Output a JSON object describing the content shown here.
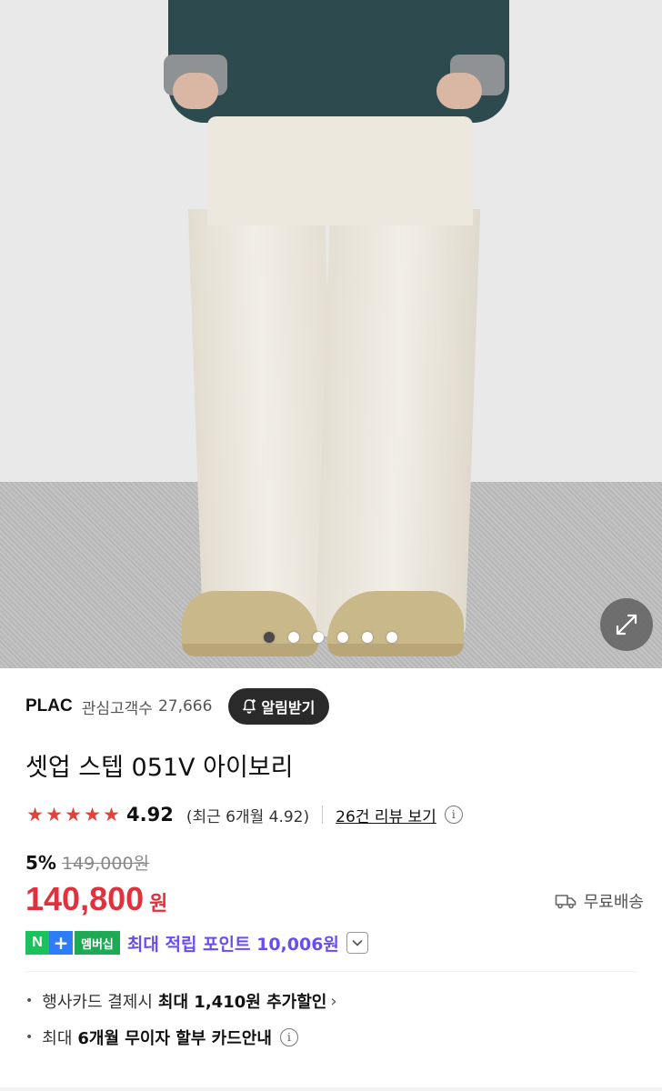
{
  "hero": {
    "dots_total": 6,
    "dots_active_index": 0
  },
  "brand": {
    "name": "PLAC",
    "fans_label": "관심고객수",
    "fans_count": "27,666",
    "alert_button": "알림받기"
  },
  "product": {
    "name": "셋업 스텝 051V 아이보리"
  },
  "rating": {
    "stars": 5,
    "value": "4.92",
    "recent": "(최근 6개월 4.92)",
    "review_link": "26건 리뷰 보기"
  },
  "price": {
    "discount": "5%",
    "original": "149,000원",
    "current": "140,800",
    "unit": "원"
  },
  "shipping": {
    "label": "무료배송"
  },
  "membership": {
    "badge_n": "N",
    "badge_plus": "+",
    "badge_label": "멤버십",
    "points_text": "최대 적립 포인트 10,006원"
  },
  "benefits": {
    "card_discount_prefix": "행사카드 결제시",
    "card_discount_bold": "최대 1,410원 추가할인",
    "installment_prefix": "최대",
    "installment_bold": "6개월 무이자 할부 카드안내"
  },
  "colors": {
    "price_red": "#e0323c",
    "star_red": "#e0433c",
    "points_purple": "#6a4df2",
    "naver_green": "#19c25b"
  }
}
